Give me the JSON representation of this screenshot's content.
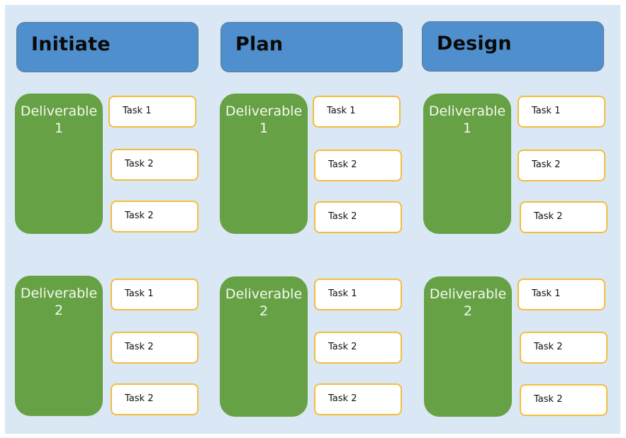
{
  "colors": {
    "background": "#dae7f4",
    "phase_header": "#4f8fcd",
    "deliverable": "#66a245",
    "task_border": "#f5bd3c",
    "task_fill": "#ffffff"
  },
  "phases": [
    {
      "title": "Initiate",
      "deliverables": [
        {
          "label": "Deliverable 1",
          "tasks": [
            "Task 1",
            "Task 2",
            "Task 2"
          ]
        },
        {
          "label": "Deliverable 2",
          "tasks": [
            "Task 1",
            "Task 2",
            "Task 2"
          ]
        }
      ]
    },
    {
      "title": "Plan",
      "deliverables": [
        {
          "label": "Deliverable 1",
          "tasks": [
            "Task 1",
            "Task 2",
            "Task 2"
          ]
        },
        {
          "label": "Deliverable 2",
          "tasks": [
            "Task 1",
            "Task 2",
            "Task 2"
          ]
        }
      ]
    },
    {
      "title": "Design",
      "deliverables": [
        {
          "label": "Deliverable 1",
          "tasks": [
            "Task 1",
            "Task 2",
            "Task 2"
          ]
        },
        {
          "label": "Deliverable 2",
          "tasks": [
            "Task 1",
            "Task 2",
            "Task 2"
          ]
        }
      ]
    }
  ]
}
